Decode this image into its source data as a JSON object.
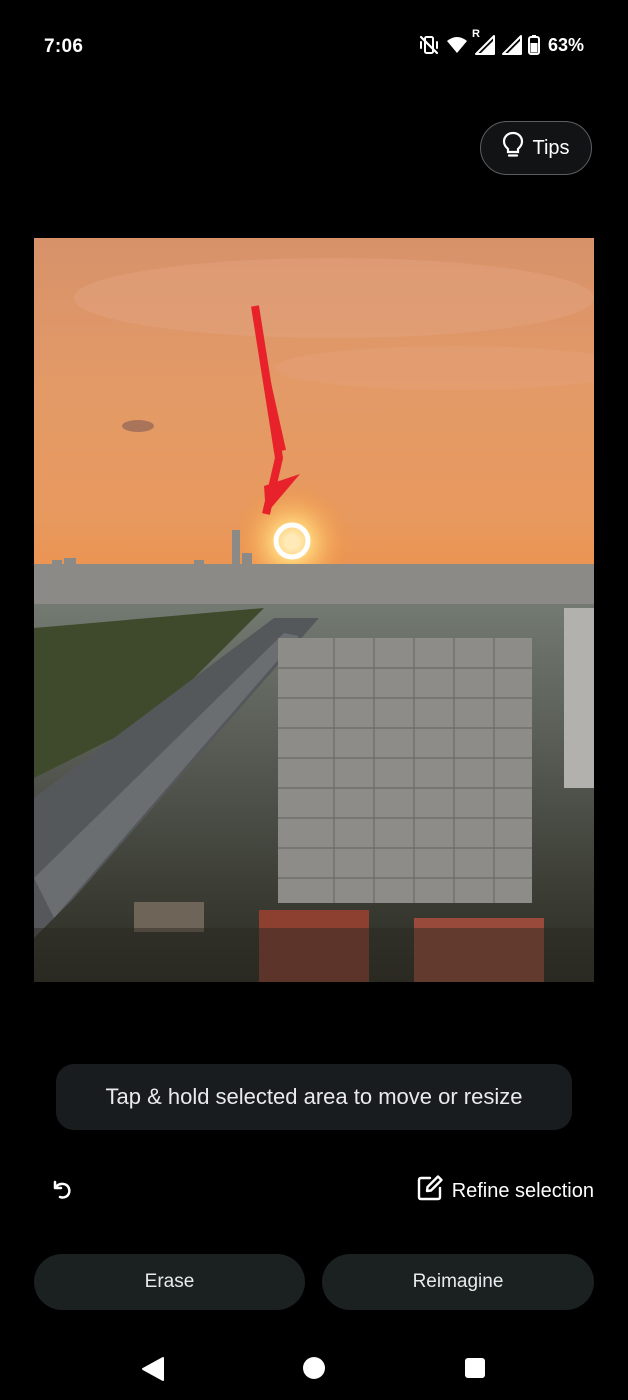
{
  "status_bar": {
    "time": "7:06",
    "signal_marker": "R",
    "battery_percent": "63%",
    "icons": [
      "mute-vibrate-icon",
      "wifi-icon",
      "roaming-signal-icon",
      "signal-icon",
      "battery-icon"
    ]
  },
  "header": {
    "tips_label": "Tips",
    "tips_icon": "lightbulb-icon"
  },
  "photo": {
    "annotation_icon": "red-arrow-icon",
    "selection_icon": "selection-circle-icon"
  },
  "hint": {
    "text": "Tap & hold selected area to move or resize"
  },
  "toolbar": {
    "undo_icon": "undo-icon",
    "refine_icon": "edit-icon",
    "refine_label": "Refine selection"
  },
  "actions": {
    "erase_label": "Erase",
    "reimagine_label": "Reimagine"
  },
  "navigation": {
    "icons": [
      "back-icon",
      "home-icon",
      "recents-icon"
    ]
  },
  "colors": {
    "background": "#000000",
    "button_bg": "#1b2021",
    "toast_bg": "#191c1e",
    "arrow": "#e8222a",
    "sunset_orange": "#ef8f48"
  }
}
